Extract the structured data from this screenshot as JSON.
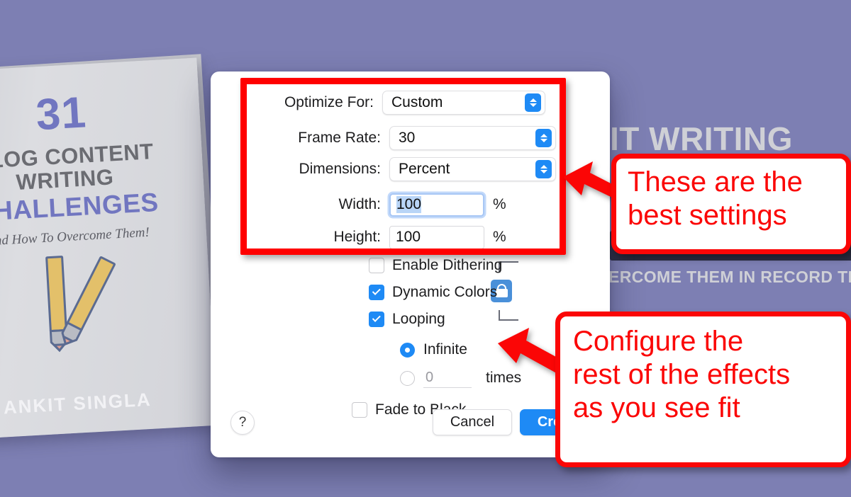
{
  "background": {
    "accent_purple": "#7d7fb3",
    "book": {
      "number": "31",
      "line1": "BLOG CONTENT",
      "line2": "WRITING",
      "line3": "CHALLENGES",
      "subtitle": "And How To Overcome Them!",
      "author": "ANKIT SINGLA"
    },
    "right_text_top": "IT WRITING",
    "right_text_bottom": "ERCOME THEM IN RECORD TIM"
  },
  "dialog": {
    "fields": {
      "optimize_for": {
        "label": "Optimize For:",
        "value": "Custom"
      },
      "frame_rate": {
        "label": "Frame Rate:",
        "value": "30"
      },
      "dimensions": {
        "label": "Dimensions:",
        "value": "Percent"
      },
      "width": {
        "label": "Width:",
        "value": "100",
        "unit": "%"
      },
      "height": {
        "label": "Height:",
        "value": "100",
        "unit": "%"
      }
    },
    "lock_icon": "lock-closed-icon",
    "checkboxes": [
      {
        "label": "Enable Dithering",
        "checked": false
      },
      {
        "label": "Dynamic Colors",
        "checked": true
      },
      {
        "label": "Looping",
        "checked": true
      }
    ],
    "loop_options": {
      "infinite": {
        "label": "Infinite",
        "selected": true
      },
      "times": {
        "value": "0",
        "label": "times",
        "selected": false
      }
    },
    "fade_to_black": {
      "label": "Fade to Black",
      "checked": false
    },
    "footer": {
      "help_label": "?",
      "cancel_label": "Cancel",
      "create_label": "Create"
    },
    "accent_blue": "#1e8af5"
  },
  "annotations": {
    "highlight_box_color": "#ff0000",
    "callout_1": {
      "line1": "These are the",
      "line2": "best settings"
    },
    "callout_2": {
      "line1": "Configure the",
      "line2": "rest of the effects",
      "line3": "as you see fit"
    }
  }
}
